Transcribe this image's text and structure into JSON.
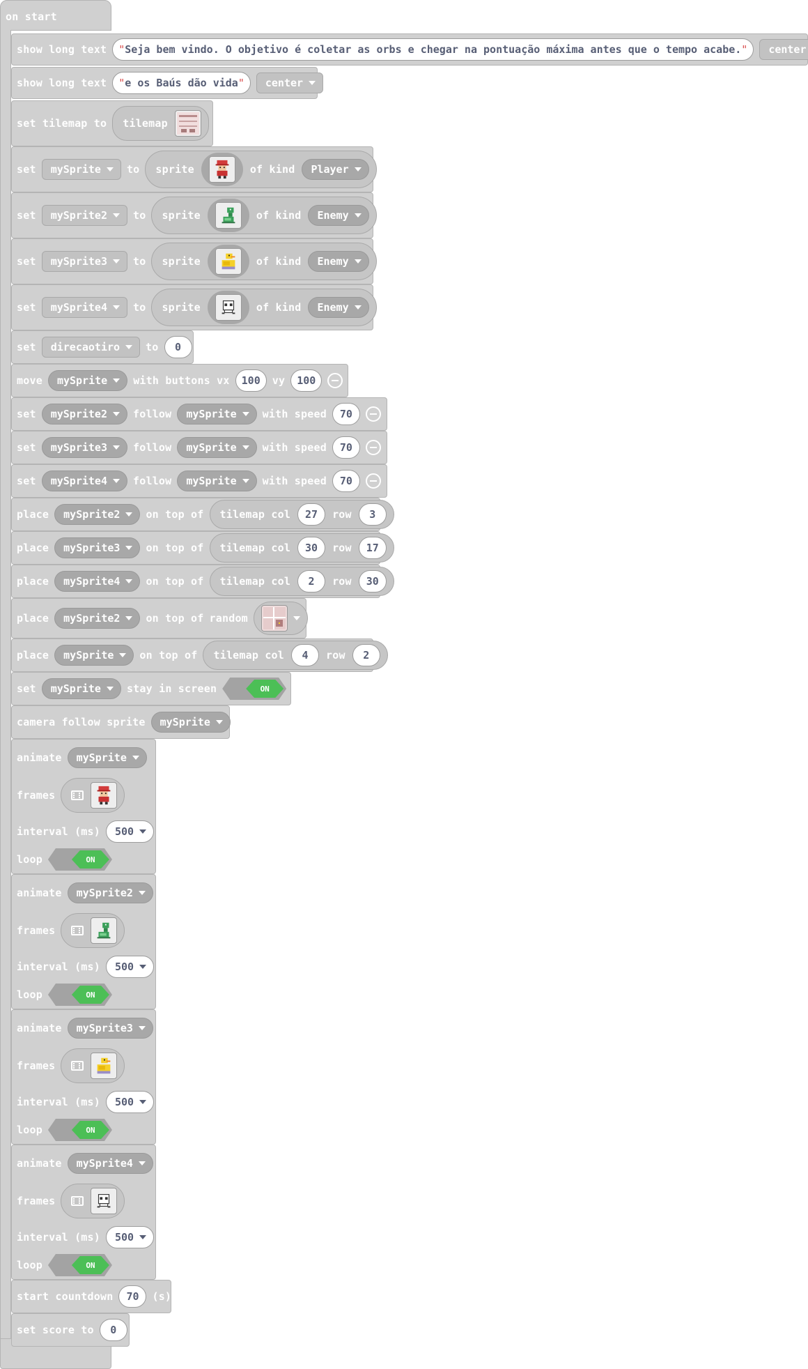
{
  "event": {
    "label": "on start"
  },
  "kw": {
    "show_long_text": "show long text",
    "set_tilemap_to": "set tilemap to",
    "set": "set",
    "to": "to",
    "sprite": "sprite",
    "of_kind": "of kind",
    "move": "move",
    "with_buttons_vx": "with buttons vx",
    "vy": "vy",
    "follow": "follow",
    "with_speed": "with speed",
    "place": "place",
    "on_top_of": "on top of",
    "tilemap_col": "tilemap col",
    "row": "row",
    "random": "random",
    "stay_in_screen": "stay in screen",
    "camera_follow_sprite": "camera follow sprite",
    "animate": "animate",
    "frames": "frames",
    "interval_ms": "interval (ms)",
    "loop": "loop",
    "start_countdown": "start countdown",
    "seconds": "(s)",
    "set_score_to": "set score to",
    "tilemap": "tilemap",
    "on": "ON"
  },
  "text1": {
    "value": "Seja bem vindo. O objetivo é coletar as orbs e chegar na pontuação máxima antes que o tempo acabe.",
    "align": "center"
  },
  "text2": {
    "value": "e os Baús dão vida",
    "align": "center"
  },
  "sprites": [
    {
      "var": "mySprite",
      "kind": "Player",
      "image": "player-sprite"
    },
    {
      "var": "mySprite2",
      "kind": "Enemy",
      "image": "snake-sprite"
    },
    {
      "var": "mySprite3",
      "kind": "Enemy",
      "image": "duck-sprite"
    },
    {
      "var": "mySprite4",
      "kind": "Enemy",
      "image": "skull-sprite"
    }
  ],
  "direcao": {
    "var": "direcaotiro",
    "value": "0"
  },
  "move": {
    "sprite": "mySprite",
    "vx": "100",
    "vy": "100"
  },
  "follows": [
    {
      "sprite": "mySprite2",
      "target": "mySprite",
      "speed": "70"
    },
    {
      "sprite": "mySprite3",
      "target": "mySprite",
      "speed": "70"
    },
    {
      "sprite": "mySprite4",
      "target": "mySprite",
      "speed": "70"
    }
  ],
  "places": [
    {
      "sprite": "mySprite2",
      "col": "27",
      "row": "3"
    },
    {
      "sprite": "mySprite3",
      "col": "30",
      "row": "17"
    },
    {
      "sprite": "mySprite4",
      "col": "2",
      "row": "30"
    }
  ],
  "place_random": {
    "sprite": "mySprite2",
    "tile": "chest-tile"
  },
  "place_player": {
    "sprite": "mySprite",
    "col": "4",
    "row": "2"
  },
  "stay": {
    "sprite": "mySprite",
    "state": "ON"
  },
  "camera": {
    "sprite": "mySprite"
  },
  "animations": [
    {
      "sprite": "mySprite",
      "interval": "500",
      "loop": "ON"
    },
    {
      "sprite": "mySprite2",
      "interval": "500",
      "loop": "ON"
    },
    {
      "sprite": "mySprite3",
      "interval": "500",
      "loop": "ON"
    },
    {
      "sprite": "mySprite4",
      "interval": "500",
      "loop": "ON"
    }
  ],
  "countdown": "70",
  "score": "0",
  "colors": {
    "block": "#d0d0d0",
    "on_toggle": "#4cbf56",
    "field_text": "#575e75"
  }
}
